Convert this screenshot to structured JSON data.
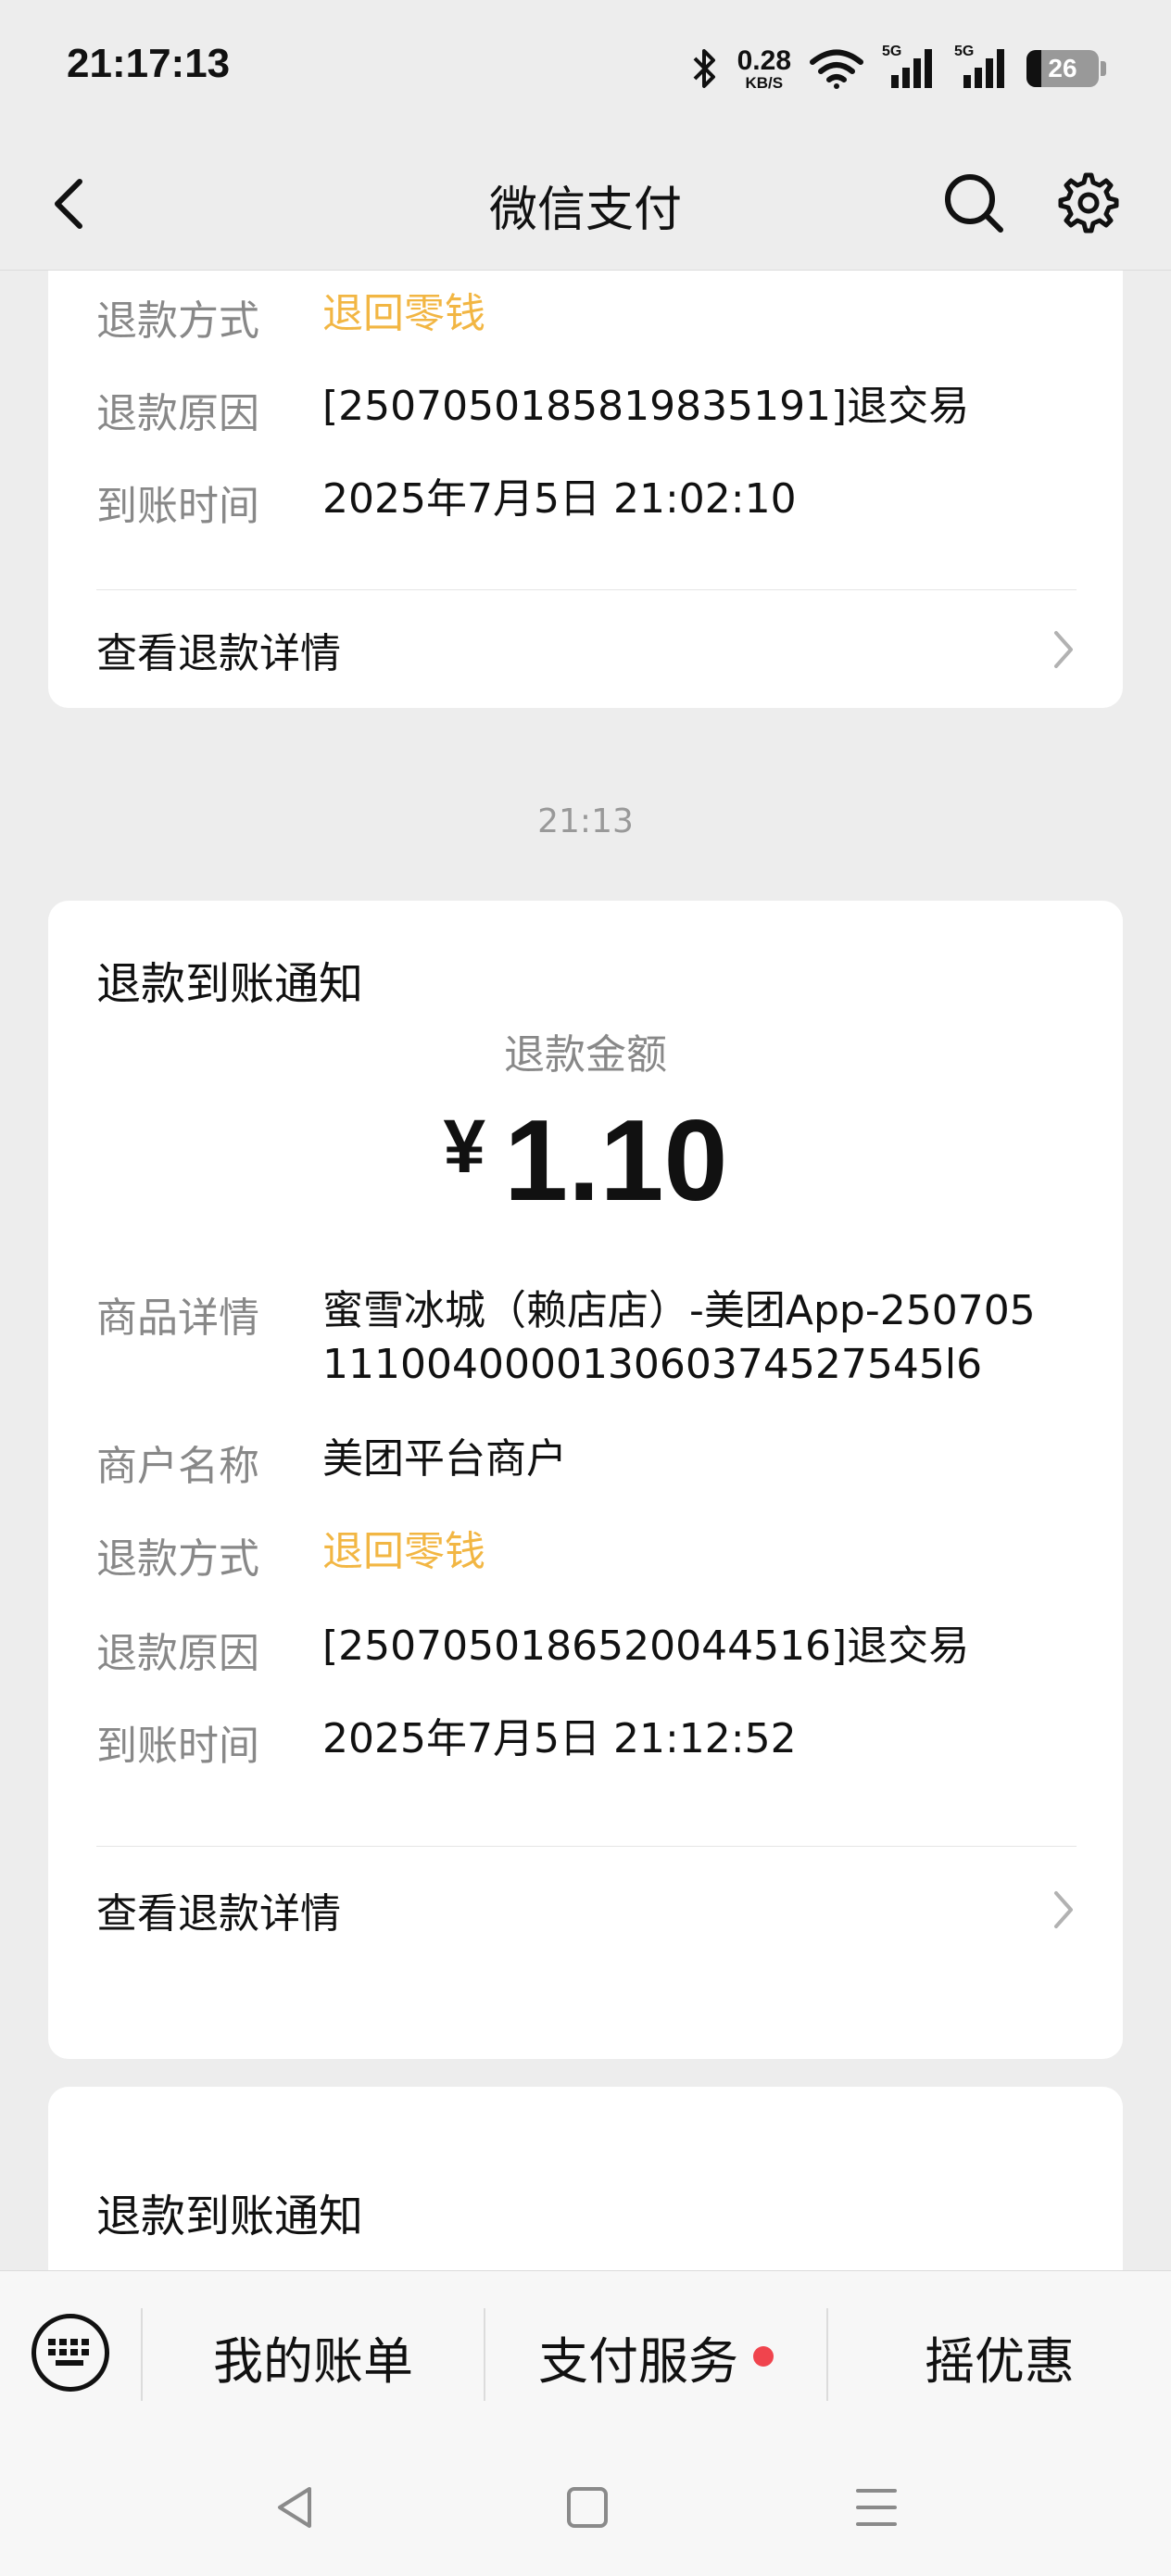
{
  "status_bar": {
    "time": "21:17:13",
    "net_speed_value": "0.28",
    "net_speed_unit": "KB/S",
    "signal1_label": "5G",
    "signal2_label": "5G",
    "battery_level": "26"
  },
  "nav": {
    "title": "微信支付"
  },
  "card1": {
    "rows": [
      {
        "label": "退款方式",
        "value": "退回零钱"
      },
      {
        "label": "退款原因",
        "value": "[2507050185819835191]退交易"
      },
      {
        "label": "到账时间",
        "value": "2025年7月5日 21:02:10"
      }
    ],
    "detail_link": "查看退款详情"
  },
  "timestamp": "21:13",
  "card2": {
    "title": "退款到账通知",
    "amount_label": "退款金额",
    "currency": "¥",
    "amount": "1.10",
    "rows": [
      {
        "label": "商品详情",
        "value_line1": "蜜雪冰城（赖店店）-美团App-250705",
        "value_line2": "111004000013060374527545l6"
      },
      {
        "label": "商户名称",
        "value": "美团平台商户"
      },
      {
        "label": "退款方式",
        "value": "退回零钱"
      },
      {
        "label": "退款原因",
        "value": "[2507050186520044516]退交易"
      },
      {
        "label": "到账时间",
        "value": "2025年7月5日 21:12:52"
      }
    ],
    "detail_link": "查看退款详情"
  },
  "card3": {
    "title": "退款到账通知"
  },
  "bottom_menu": {
    "items": [
      "我的账单",
      "支付服务",
      "摇优惠"
    ]
  }
}
